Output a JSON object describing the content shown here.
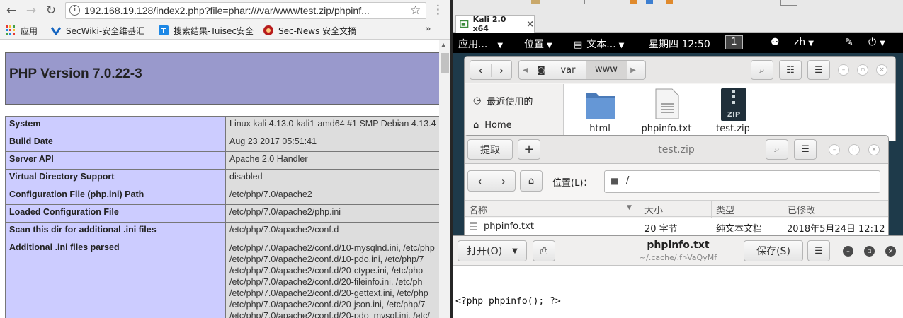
{
  "browser": {
    "url": "192.168.19.128/index2.php?file=phar:///var/www/test.zip/phpinf...",
    "bookmarks": [
      "应用",
      "SecWiki-安全维基汇",
      "搜索结果-Tuisec安全",
      "Sec-News 安全文摘"
    ],
    "more": "»"
  },
  "php": {
    "title": "PHP Version 7.0.22-3",
    "rows": [
      {
        "key": "System",
        "value": "Linux kali 4.13.0-kali1-amd64 #1 SMP Debian 4.13.4"
      },
      {
        "key": "Build Date",
        "value": "Aug 23 2017 05:51:41"
      },
      {
        "key": "Server API",
        "value": "Apache 2.0 Handler"
      },
      {
        "key": "Virtual Directory Support",
        "value": "disabled"
      },
      {
        "key": "Configuration File (php.ini) Path",
        "value": "/etc/php/7.0/apache2"
      },
      {
        "key": "Loaded Configuration File",
        "value": "/etc/php/7.0/apache2/php.ini"
      },
      {
        "key": "Scan this dir for additional .ini files",
        "value": "/etc/php/7.0/apache2/conf.d"
      }
    ],
    "ini_key": "Additional .ini files parsed",
    "ini_lines": [
      "/etc/php/7.0/apache2/conf.d/10-mysqlnd.ini, /etc/php",
      "/etc/php/7.0/apache2/conf.d/10-pdo.ini, /etc/php/7",
      "/etc/php/7.0/apache2/conf.d/20-ctype.ini, /etc/php",
      "/etc/php/7.0/apache2/conf.d/20-fileinfo.ini, /etc/ph",
      "/etc/php/7.0/apache2/conf.d/20-gettext.ini, /etc/php",
      "/etc/php/7.0/apache2/conf.d/20-json.ini, /etc/php/7",
      "/etc/php/7.0/apache2/conf.d/20-pdo_mysql.ini, /etc/"
    ]
  },
  "vm": {
    "tab_label": "Kali 2.0 x64",
    "tab_close": "×",
    "gnome": {
      "apps": "应用...",
      "places": "位置",
      "editor": "文本...",
      "clock": "星期四 12:50",
      "workspace": "1",
      "lang": "zh"
    }
  },
  "nautilus1": {
    "path": [
      "var",
      "www"
    ],
    "sidebar": [
      "最近使用的",
      "Home"
    ],
    "files": [
      "html",
      "phpinfo.txt",
      "test.zip"
    ]
  },
  "nautilus2": {
    "extract_label": "提取",
    "add_label": "+",
    "title": "test.zip",
    "location_label": "位置(L)：",
    "location_value": "/",
    "columns": [
      "名称",
      "大小",
      "类型",
      "已修改"
    ],
    "row": {
      "name": "phpinfo.txt",
      "size": "20 字节",
      "type": "纯文本文档",
      "modified": "2018年5月24日 12:12"
    }
  },
  "gedit": {
    "open_label": "打开(O)",
    "title": "phpinfo.txt",
    "subtitle": "~/.cache/.fr-VaQyMf",
    "save_label": "保存(S)",
    "content": "<?php phpinfo(); ?>"
  }
}
